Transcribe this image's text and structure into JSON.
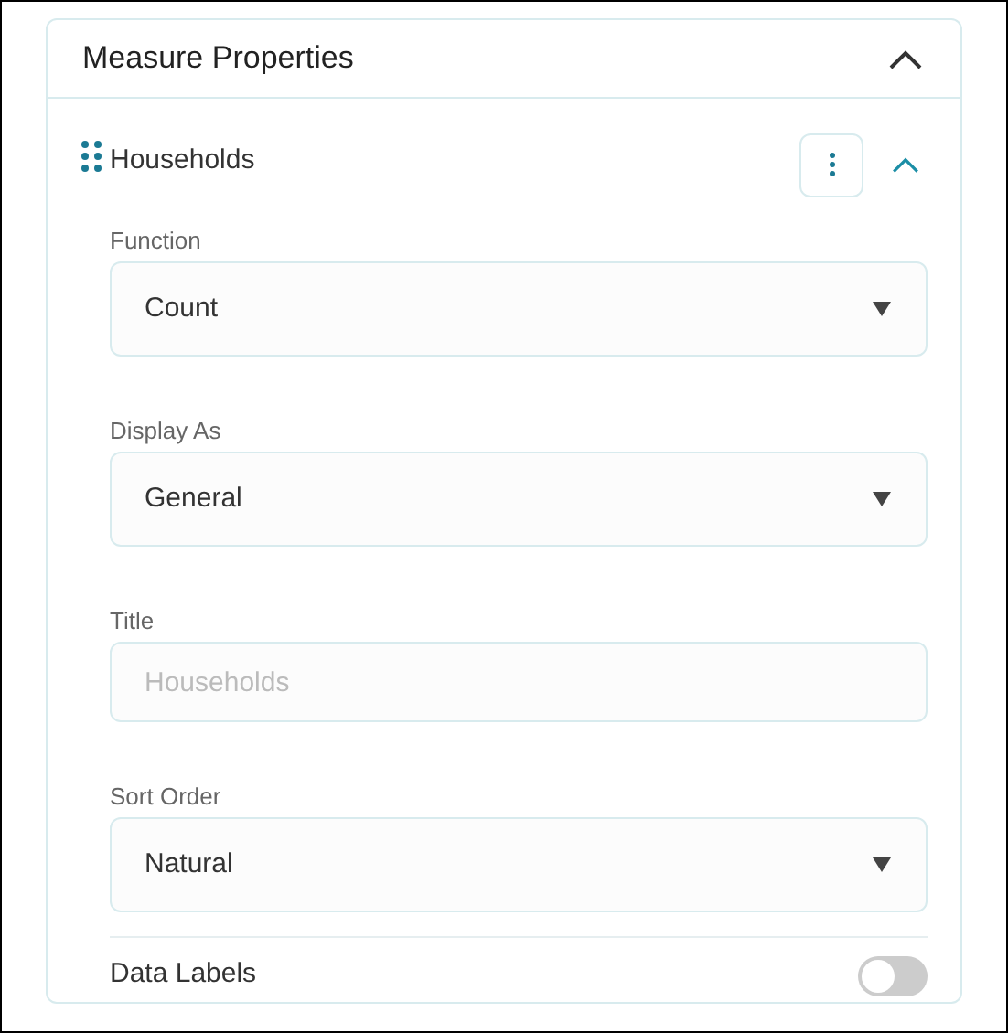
{
  "panel": {
    "title": "Measure Properties",
    "expanded": true
  },
  "measure": {
    "name": "Households",
    "expanded": true
  },
  "fields": [
    {
      "kind": "select",
      "label": "Function",
      "value": "Count"
    },
    {
      "kind": "select",
      "label": "Display As",
      "value": "General"
    },
    {
      "kind": "text",
      "label": "Title",
      "placeholder": "Households"
    },
    {
      "kind": "select",
      "label": "Sort Order",
      "value": "Natural"
    }
  ],
  "toggle": {
    "label": "Data Labels",
    "on": false
  }
}
